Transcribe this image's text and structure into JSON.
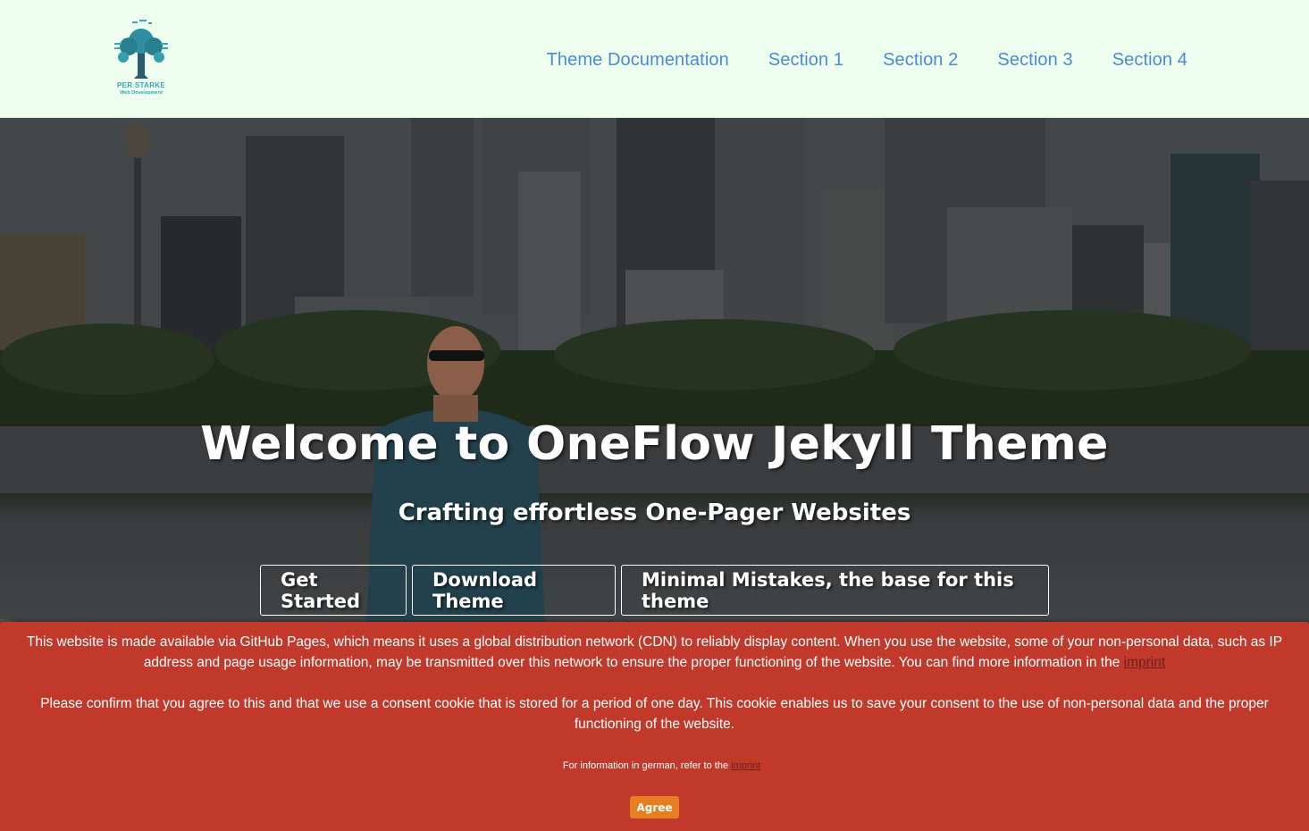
{
  "brand": {
    "name": "PER STARKE",
    "tagline": "Web Development",
    "logo_icon": "tree-circuit-logo"
  },
  "nav": {
    "items": [
      {
        "label": "Theme Documentation"
      },
      {
        "label": "Section 1"
      },
      {
        "label": "Section 2"
      },
      {
        "label": "Section 3"
      },
      {
        "label": "Section 4"
      }
    ],
    "color": "#4a8bd0"
  },
  "hero": {
    "title": "Welcome to OneFlow Jekyll Theme",
    "subtitle": "Crafting effortless One-Pager Websites",
    "buttons": [
      {
        "label": "Get Started"
      },
      {
        "label": "Download Theme"
      },
      {
        "label": "Minimal Mistakes, the base for this theme"
      }
    ]
  },
  "consent": {
    "paragraph1": "This website is made available via GitHub Pages, which means it uses a global distribution network (CDN) to reliably display content. When you use the website, some of your non-personal data, such as IP address and page usage information, may be transmitted over this network to ensure the proper functioning of the website. You can find more information in the ",
    "paragraph1_link": "imprint",
    "paragraph2": "Please confirm that you agree to this and that we use a consent cookie that is stored for a period of one day. This cookie enables us to save your consent to the use of non-personal data and the proper functioning of the website.",
    "german_note": "For information in german, refer to the ",
    "german_link": "imprint",
    "agree_label": "Agree",
    "background": "#c0392b",
    "button_color": "#e67e22"
  },
  "colors": {
    "header_bg": "#eefff0"
  }
}
